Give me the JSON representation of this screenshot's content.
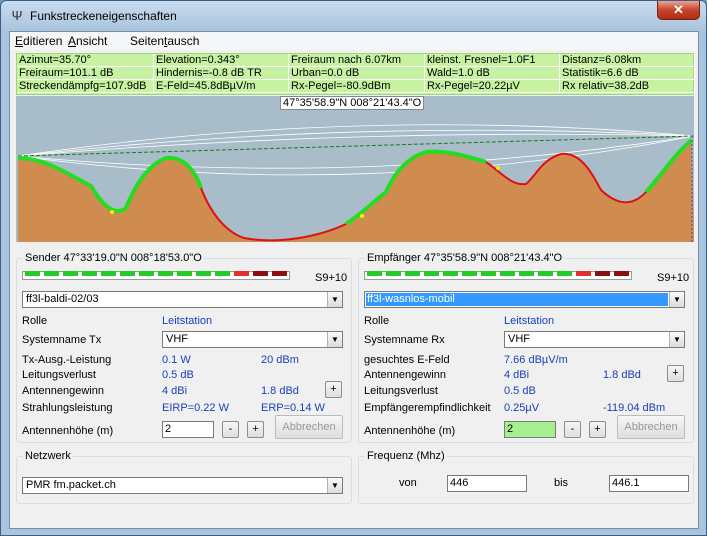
{
  "window": {
    "title": "Funkstreckeneigenschaften",
    "icon": "antenna-icon",
    "close_glyph": "✕"
  },
  "menu": [
    {
      "label_before": "",
      "accel": "E",
      "label_after": "ditieren"
    },
    {
      "label_before": "",
      "accel": "A",
      "label_after": "nsicht"
    },
    {
      "label_before": "Seiten",
      "accel": "t",
      "label_after": "ausch"
    }
  ],
  "info": {
    "row1": [
      "Azimut=35.70°",
      "Elevation=0.343°",
      "Freiraum nach 6.07km",
      "kleinst. Fresnel=1.0F1",
      "Distanz=6.08km"
    ],
    "row2": [
      "Freiraum=101.1 dB",
      "Hindernis=-0.8 dB TR",
      "Urban=0.0 dB",
      "Wald=1.0 dB",
      "Statistik=6.6 dB"
    ],
    "row3": [
      "Streckendämpfg=107.9dB",
      "E-Feld=45.8dBµV/m",
      "Rx-Pegel=-80.9dBm",
      "Rx-Pegel=20.22µV",
      "Rx relativ=38.2dB"
    ],
    "coordinate": "47°35'58.9\"N 008°21'43.4\"O"
  },
  "sender": {
    "title": "Sender 47°33'19.0\"N 008°18'53.0\"O",
    "meter_label": "S9+10",
    "station": "ff3l-baldi-02/03",
    "rolle_label": "Rolle",
    "rolle_value": "Leitstation",
    "systemname_label": "Systemname Tx",
    "systemname_value": "VHF",
    "leistung_label": "Tx-Ausg.-Leistung",
    "leistung_w": "0.1 W",
    "leistung_dbm": "20 dBm",
    "verlust_label": "Leitungsverlust",
    "verlust_value": "0.5 dB",
    "gewinn_label": "Antennengewinn",
    "gewinn_dbi": "4 dBi",
    "gewinn_dbd": "1.8 dBd",
    "strahlung_label": "Strahlungsleistung",
    "eirp": "EIRP=0.22 W",
    "erp": "ERP=0.14 W",
    "hoehe_label": "Antennenhöhe (m)",
    "hoehe_value": "2",
    "minus": "-",
    "plus": "+",
    "abbrechen": "Abbrechen"
  },
  "empfaenger": {
    "title": "Empfänger 47°35'58.9\"N 008°21'43.4\"O",
    "meter_label": "S9+10",
    "station": "ff3l-wasnlos-mobil",
    "rolle_label": "Rolle",
    "rolle_value": "Leitstation",
    "systemname_label": "Systemname Rx",
    "systemname_value": "VHF",
    "efeld_label": "gesuchtes E-Feld",
    "efeld_value": "7.66 dBµV/m",
    "gewinn_label": "Antennengewinn",
    "gewinn_dbi": "4 dBi",
    "gewinn_dbd": "1.8 dBd",
    "verlust_label": "Leitungsverlust",
    "verlust_value": "0.5 dB",
    "empf_label": "Empfängerempfindlichkeit",
    "empf_uv": "0.25µV",
    "empf_dbm": "-119.04 dBm",
    "hoehe_label": "Antennenhöhe (m)",
    "hoehe_value": "2",
    "minus": "-",
    "plus": "+",
    "abbrechen": "Abbrechen"
  },
  "netzwerk": {
    "title": "Netzwerk",
    "value": "PMR fm.packet.ch"
  },
  "frequenz": {
    "title": "Frequenz (Mhz)",
    "von_label": "von",
    "von_value": "446",
    "bis_label": "bis",
    "bis_value": "446.1"
  },
  "colors": {
    "sky": "#a8bdc9",
    "terrain": "#d08b4e",
    "line_good": "#22dd22",
    "line_bad": "#e01010",
    "line_mid": "#f0f000",
    "meter_green": "#22cc22",
    "meter_red": "#e03030",
    "meter_dark": "#8b1010"
  }
}
